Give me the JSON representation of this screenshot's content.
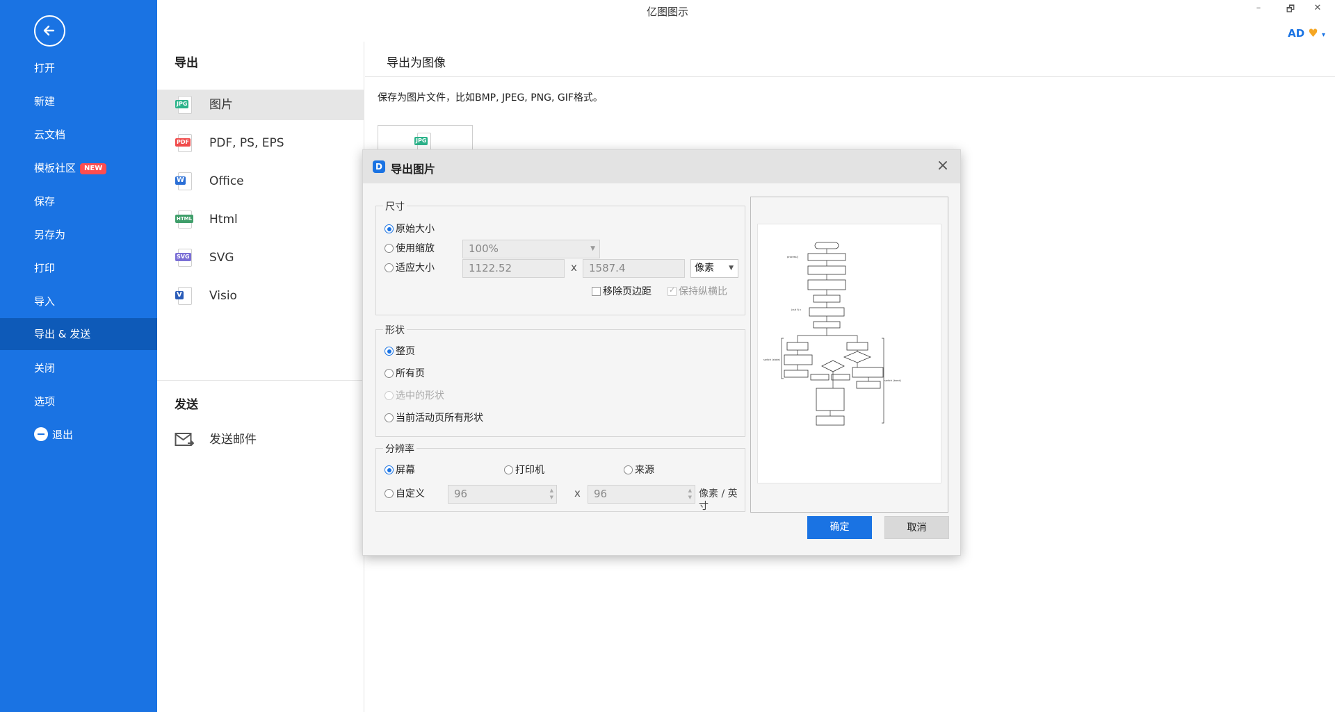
{
  "window": {
    "title": "亿图图示",
    "minimize": "–",
    "restore": "🗗",
    "close": "✕",
    "user_initials": "AD",
    "vip_icon": "♥",
    "dropdown_caret": "▾"
  },
  "sidebar": {
    "back_icon": "arrow-left-circle-icon",
    "items": [
      {
        "label": "打开"
      },
      {
        "label": "新建"
      },
      {
        "label": "云文档"
      },
      {
        "label": "模板社区",
        "badge": "NEW"
      },
      {
        "label": "保存"
      },
      {
        "label": "另存为"
      },
      {
        "label": "打印"
      },
      {
        "label": "导入"
      },
      {
        "label": "导出 & 发送",
        "active": true
      },
      {
        "label": "关闭"
      },
      {
        "label": "选项"
      },
      {
        "label": "退出"
      }
    ],
    "accent_color": "#1a73e3",
    "active_color": "#0e5ab8"
  },
  "export_panel": {
    "heading": "导出",
    "items": [
      {
        "label": "图片",
        "tag": "JPG",
        "tag_color": "#2bb38a",
        "active": true
      },
      {
        "label": "PDF, PS, EPS",
        "tag": "PDF",
        "tag_color": "#f04b4b"
      },
      {
        "label": "Office",
        "tag": "W",
        "tag_color": "#2b6fd6"
      },
      {
        "label": "Html",
        "tag": "HTML",
        "tag_color": "#3f9e6a"
      },
      {
        "label": "SVG",
        "tag": "SVG",
        "tag_color": "#7b6fd6"
      },
      {
        "label": "Visio",
        "tag": "V",
        "tag_color": "#2a5cb8"
      }
    ],
    "send_heading": "发送",
    "send_items": [
      {
        "label": "发送邮件"
      }
    ]
  },
  "content": {
    "title": "导出为图像",
    "description": "保存为图片文件，比如BMP, JPEG, PNG, GIF格式。",
    "thumb_tag": "JPG"
  },
  "dialog": {
    "title": "导出图片",
    "logo": "D",
    "close": "×",
    "size_group": {
      "legend": "尺寸",
      "original": "原始大小",
      "use_scale": "使用缩放",
      "scale_value": "100%",
      "fit_size": "适应大小",
      "width": "1122.52",
      "height": "1587.4",
      "times": "x",
      "unit": "像素",
      "remove_margin": "移除页边距",
      "keep_ratio": "保持纵横比"
    },
    "shape_group": {
      "legend": "形状",
      "whole_page": "整页",
      "all_pages": "所有页",
      "selected_shapes": "选中的形状",
      "current_page_shapes": "当前活动页所有形状"
    },
    "resolution_group": {
      "legend": "分辨率",
      "screen": "屏幕",
      "printer": "打印机",
      "source": "来源",
      "custom": "自定义",
      "dpi_x": "96",
      "dpi_y": "96",
      "times": "x",
      "unit": "像素 / 英寸"
    },
    "ok": "确定",
    "cancel": "取消"
  }
}
